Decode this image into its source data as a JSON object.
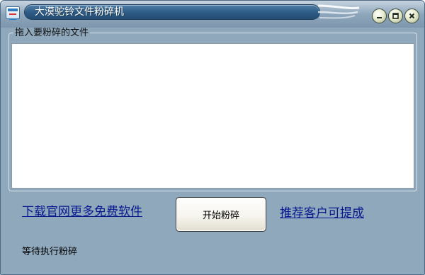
{
  "window": {
    "title": "大漠驼铃文件粉碎机",
    "icon": "app-icon",
    "controls": {
      "minimize": "minimize-icon",
      "maximize": "maximize-icon",
      "close": "close-icon"
    }
  },
  "drop_group": {
    "label": "拖入要粉碎的文件",
    "files": []
  },
  "actions": {
    "download_link": "下载官网更多免费软件",
    "start_button": "开始粉碎",
    "recommend_link": "推荐客户可提成"
  },
  "status": {
    "text": "等待执行粉碎"
  },
  "colors": {
    "window_background": "#8fa8bb",
    "title_capsule": "#2c5a84",
    "link": "#08188f"
  }
}
